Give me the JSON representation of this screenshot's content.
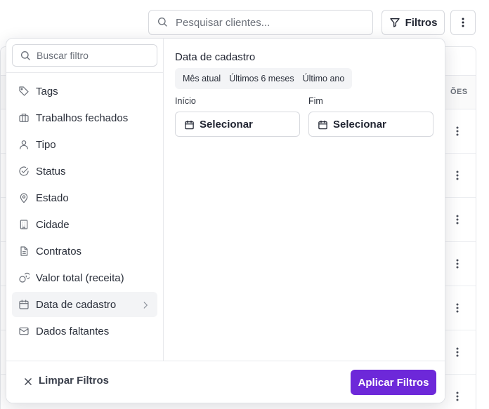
{
  "topbar": {
    "search_placeholder": "Pesquisar clientes...",
    "filters_label": "Filtros"
  },
  "table": {
    "actions_header": "ÕES"
  },
  "filter_panel": {
    "search_placeholder": "Buscar filtro",
    "items": [
      {
        "label": "Tags",
        "icon": "tag-icon"
      },
      {
        "label": "Trabalhos fechados",
        "icon": "briefcase-icon"
      },
      {
        "label": "Tipo",
        "icon": "user-icon"
      },
      {
        "label": "Status",
        "icon": "check-circle-icon"
      },
      {
        "label": "Estado",
        "icon": "map-pin-icon"
      },
      {
        "label": "Cidade",
        "icon": "building-icon"
      },
      {
        "label": "Contratos",
        "icon": "file-text-icon"
      },
      {
        "label": "Valor total (receita)",
        "icon": "coins-icon"
      },
      {
        "label": "Data de cadastro",
        "icon": "calendar-icon",
        "active": true
      },
      {
        "label": "Dados faltantes",
        "icon": "mail-icon"
      }
    ],
    "detail": {
      "title": "Data de cadastro",
      "quick_ranges": [
        "Mês atual",
        "Últimos 6 meses",
        "Último ano"
      ],
      "start_label": "Início",
      "end_label": "Fim",
      "start_value": "Selecionar",
      "end_value": "Selecionar"
    },
    "footer": {
      "clear_label": "Limpar Filtros",
      "apply_label": "Aplicar Filtros"
    }
  },
  "colors": {
    "accent": "#6d28d9",
    "border": "#d7d9de",
    "active_bg": "#f3f4f6"
  }
}
